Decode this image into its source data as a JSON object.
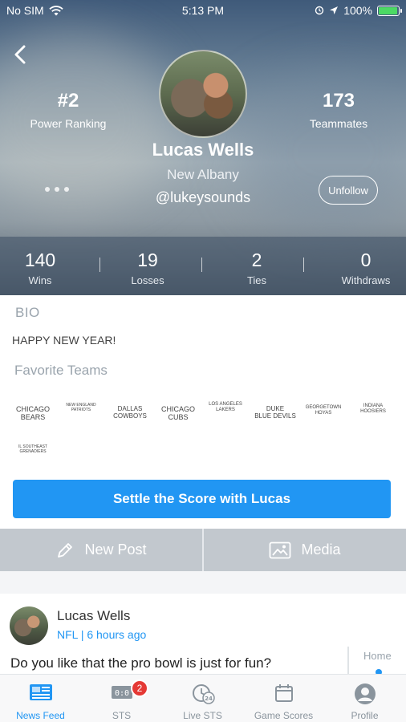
{
  "status_bar": {
    "carrier": "No SIM",
    "time": "5:13 PM",
    "battery": "100%",
    "battery_level": 1.0
  },
  "profile": {
    "name": "Lucas Wells",
    "city": "New Albany",
    "handle": "@lukeysounds",
    "ranking_value": "#2",
    "ranking_label": "Power Ranking",
    "teammates_value": "173",
    "teammates_label": "Teammates",
    "unfollow_label": "Unfollow"
  },
  "stats": [
    {
      "value": "140",
      "label": "Wins"
    },
    {
      "value": "19",
      "label": "Losses"
    },
    {
      "value": "2",
      "label": "Ties"
    },
    {
      "value": "0",
      "label": "Withdraws"
    }
  ],
  "bio": {
    "title": "BIO",
    "text": "HAPPY NEW YEAR!"
  },
  "favorites": {
    "title": "Favorite Teams",
    "teams": [
      "CHICAGO\nBEARS",
      "NEW ENGLAND\nPATRIOTS",
      "DALLAS\nCOWBOYS",
      "CHICAGO\nCUBS",
      "LOS ANGELES\nLAKERS",
      "DUKE\nBLUE DEVILS",
      "GEORGETOWN\nHOYAS",
      "INDIANA\nHOOSIERS",
      "IL SOUTHEAST\nGRENADIERS"
    ]
  },
  "cta": {
    "label": "Settle the Score with Lucas"
  },
  "actions": {
    "new_post": "New Post",
    "media": "Media"
  },
  "post": {
    "author": "Lucas Wells",
    "meta": "NFL | 6 hours ago",
    "text": "Do you like that the pro bowl is just for fun?",
    "side_tag": "Home"
  },
  "tabs": [
    {
      "label": "News Feed",
      "icon": "newspaper-icon",
      "active": true
    },
    {
      "label": "STS",
      "icon": "scoreboard-icon",
      "badge": "2"
    },
    {
      "label": "Live STS",
      "icon": "live-24-icon"
    },
    {
      "label": "Game Scores",
      "icon": "calendar-icon"
    },
    {
      "label": "Profile",
      "icon": "person-icon"
    }
  ],
  "colors": {
    "accent": "#2196f3",
    "badge": "#e53935",
    "action_bar": "#c2c8ce"
  }
}
